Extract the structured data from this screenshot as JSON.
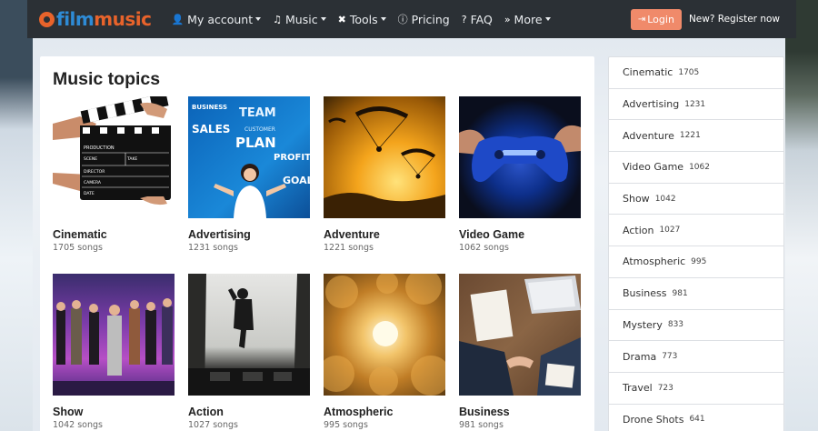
{
  "brand": {
    "part1": "film",
    "part2": "music"
  },
  "nav": {
    "items": [
      {
        "label": "My account",
        "icon": "user-icon",
        "glyph": "👤",
        "caret": true
      },
      {
        "label": "Music",
        "icon": "music-note-icon",
        "glyph": "♫",
        "caret": true
      },
      {
        "label": "Tools",
        "icon": "tools-icon",
        "glyph": "✖",
        "caret": true
      },
      {
        "label": "Pricing",
        "icon": "info-icon",
        "glyph": "ⓘ",
        "caret": false
      },
      {
        "label": "FAQ",
        "icon": "question-icon",
        "glyph": "?",
        "caret": false
      },
      {
        "label": "More",
        "icon": "double-chevron-icon",
        "glyph": "»",
        "caret": true
      }
    ],
    "login_label": "Login",
    "register_label": "New? Register now"
  },
  "main": {
    "title": "Music topics",
    "topics": [
      {
        "name": "Cinematic",
        "count": "1705 songs"
      },
      {
        "name": "Advertising",
        "count": "1231 songs"
      },
      {
        "name": "Adventure",
        "count": "1221 songs"
      },
      {
        "name": "Video Game",
        "count": "1062 songs"
      },
      {
        "name": "Show",
        "count": "1042 songs"
      },
      {
        "name": "Action",
        "count": "1027 songs"
      },
      {
        "name": "Atmospheric",
        "count": "995 songs"
      },
      {
        "name": "Business",
        "count": "981 songs"
      }
    ],
    "clapper_text": [
      "PRODUCTION",
      "SCENE",
      "TAKE",
      "DIRECTOR",
      "CAMERA",
      "DATE"
    ],
    "ad_words": [
      "BUSINESS",
      "TEAM",
      "SALES",
      "CUSTOMER",
      "PLAN",
      "PROFIT",
      "GOAL"
    ]
  },
  "sidebar": {
    "items": [
      {
        "label": "Cinematic",
        "count": "1705"
      },
      {
        "label": "Advertising",
        "count": "1231"
      },
      {
        "label": "Adventure",
        "count": "1221"
      },
      {
        "label": "Video Game",
        "count": "1062"
      },
      {
        "label": "Show",
        "count": "1042"
      },
      {
        "label": "Action",
        "count": "1027"
      },
      {
        "label": "Atmospheric",
        "count": "995"
      },
      {
        "label": "Business",
        "count": "981"
      },
      {
        "label": "Mystery",
        "count": "833"
      },
      {
        "label": "Drama",
        "count": "773"
      },
      {
        "label": "Travel",
        "count": "723"
      },
      {
        "label": "Drone Shots",
        "count": "641"
      }
    ]
  },
  "colors": {
    "navbar": "#2b3035",
    "brand_blue": "#2e8bd6",
    "brand_orange": "#e8632b",
    "login": "#f08a6a"
  }
}
